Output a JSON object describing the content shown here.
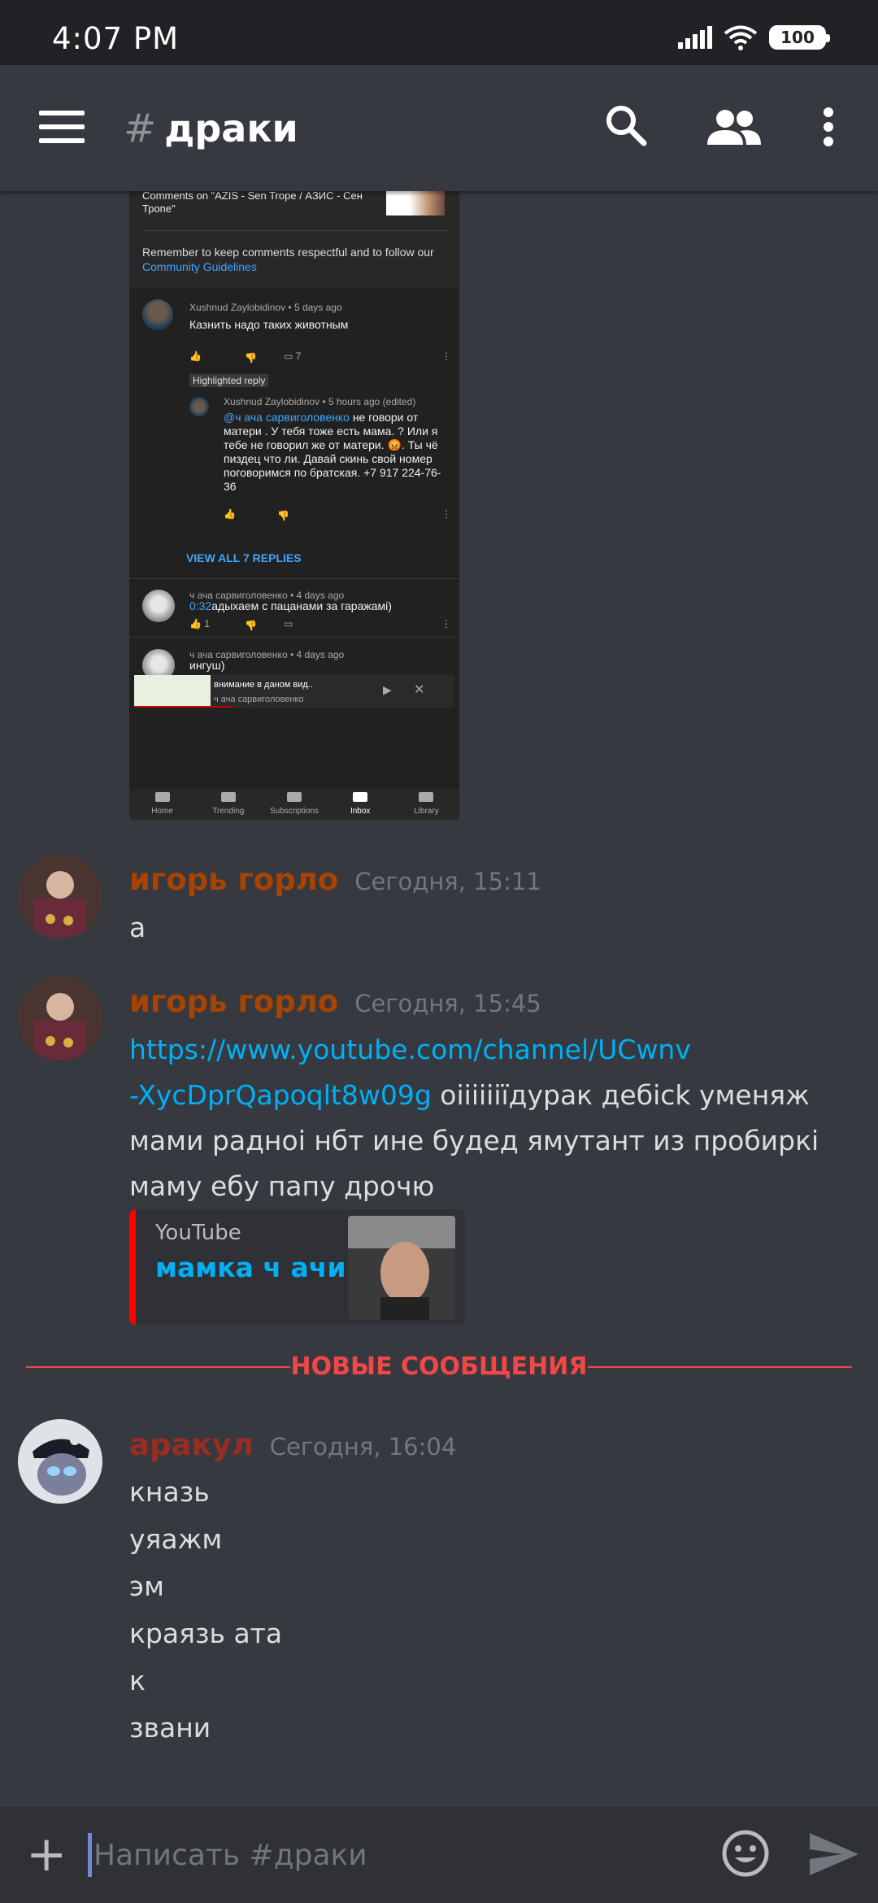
{
  "status_bar": {
    "time": "4:07 PM",
    "battery": "100"
  },
  "topbar": {
    "hash": "#",
    "channel": "драки"
  },
  "youtube_shot": {
    "comments_on": "Comments on \"AZIS - Sen Trope / АЗИС - Сен Тропе\"",
    "remind_text": "Remember to keep comments respectful and to follow our ",
    "remind_link": "Community Guidelines",
    "c1_meta": "Xushnud Zaylobidinov • 5 days ago",
    "c1_text": "Казнить надо таких животным",
    "c1_replies": "7",
    "highlighted": "Highlighted reply",
    "r1_meta": "Xushnud Zaylobidinov • 5 hours ago (edited)",
    "r1_mention": "@ч ача сарвиголовенко",
    "r1_text": " не говори от матери . У тебя тоже есть мама. ? Или я тебе не говорил же от матери. 😡. Ты чё пиздец что ли. Давай скинь свой номер поговоримся по братская. +7 917 224-76-36",
    "view_all": "VIEW ALL 7 REPLIES",
    "c2_meta": "ч ача сарвиголовенко • 4 days ago",
    "c2_time": "0:32",
    "c2_text": "адыхаем с пацанами за гаражамі)",
    "c2_likes": "1",
    "c3_meta": "ч ача сарвиголовенко • 4 days ago",
    "c3_text": "ингуш)",
    "mini_title": "внимание в даном вид..",
    "mini_channel": "ч ача сарвиголовенко",
    "nav": [
      "Home",
      "Trending",
      "Subscriptions",
      "Inbox",
      "Library"
    ]
  },
  "messages": [
    {
      "user": "игорь горло",
      "user_color": "#a84300",
      "time": "Сегодня, 15:11",
      "lines": [
        "а"
      ]
    },
    {
      "user": "игорь горло",
      "user_color": "#a84300",
      "time": "Сегодня, 15:45",
      "link1": "https://www.youtube.com/channel/UCwnv",
      "link2": "-XycDprQapoqlt8w09g",
      "text1": " oiiiiiiїдурак дебіck уменяж",
      "text2": "мами радноі нбт ине будед ямутант из пробиркі",
      "text3": "маму ебу папу дрочю",
      "embed": {
        "provider": "YouTube",
        "title": "мамка ч ачи"
      }
    },
    {
      "user": "аракул",
      "user_color": "#992d22",
      "time": "Сегодня, 16:04",
      "lines": [
        "кназь",
        "уяажм",
        "эм",
        "краязь ата",
        "к",
        "звани"
      ]
    }
  ],
  "divider": "НОВЫЕ СООБЩЕНИЯ",
  "composer": {
    "placeholder": "Написать #драки"
  },
  "colors": {
    "accent_link": "#00b0f4",
    "new_messages": "#f04747",
    "background": "#36393f"
  }
}
